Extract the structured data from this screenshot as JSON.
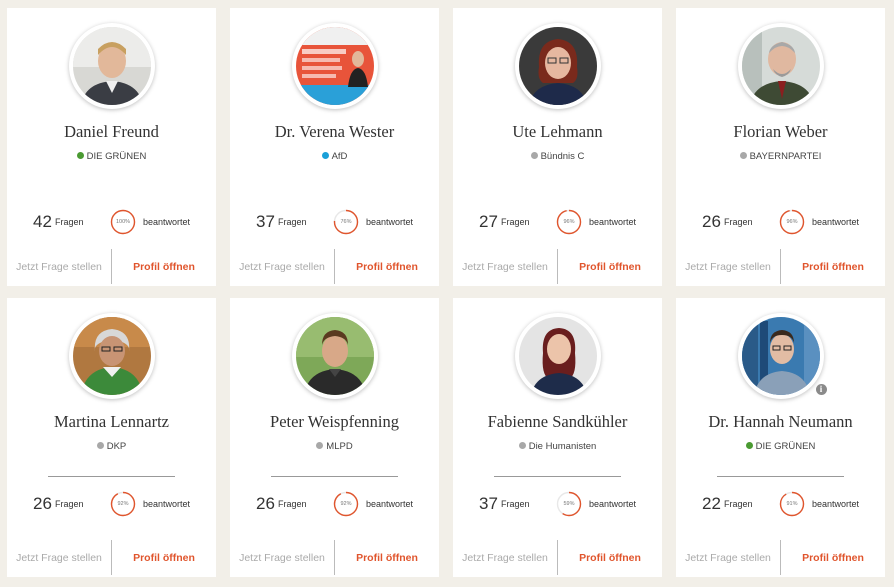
{
  "accent_color": "#e0552d",
  "questions_label": "Fragen",
  "answered_label": "beantwortet",
  "ask_label": "Jetzt Frage stellen",
  "open_label": "Profil öffnen",
  "cards": [
    {
      "name": "Daniel Freund",
      "party": "DIE GRÜNEN",
      "party_color": "#4a9a32",
      "questions": "42",
      "percent_text": "100%",
      "percent": 100
    },
    {
      "name": "Dr. Verena Wester",
      "party": "AfD",
      "party_color": "#1aa0d8",
      "questions": "37",
      "percent_text": "76%",
      "percent": 76
    },
    {
      "name": "Ute Lehmann",
      "party": "Bündnis C",
      "party_color": "#a8a8a8",
      "questions": "27",
      "percent_text": "96%",
      "percent": 96
    },
    {
      "name": "Florian Weber",
      "party": "BAYERNPARTEI",
      "party_color": "#a8a8a8",
      "questions": "26",
      "percent_text": "96%",
      "percent": 96
    },
    {
      "name": "Martina Lennartz",
      "party": "DKP",
      "party_color": "#a8a8a8",
      "questions": "26",
      "percent_text": "92%",
      "percent": 92
    },
    {
      "name": "Peter Weispfenning",
      "party": "MLPD",
      "party_color": "#a8a8a8",
      "questions": "26",
      "percent_text": "92%",
      "percent": 92
    },
    {
      "name": "Fabienne Sandkühler",
      "party": "Die Humanisten",
      "party_color": "#a8a8a8",
      "questions": "37",
      "percent_text": "59%",
      "percent": 59
    },
    {
      "name": "Dr. Hannah Neumann",
      "party": "DIE GRÜNEN",
      "party_color": "#4a9a32",
      "questions": "22",
      "percent_text": "91%",
      "percent": 91
    }
  ],
  "avatar_info_icon": "i"
}
